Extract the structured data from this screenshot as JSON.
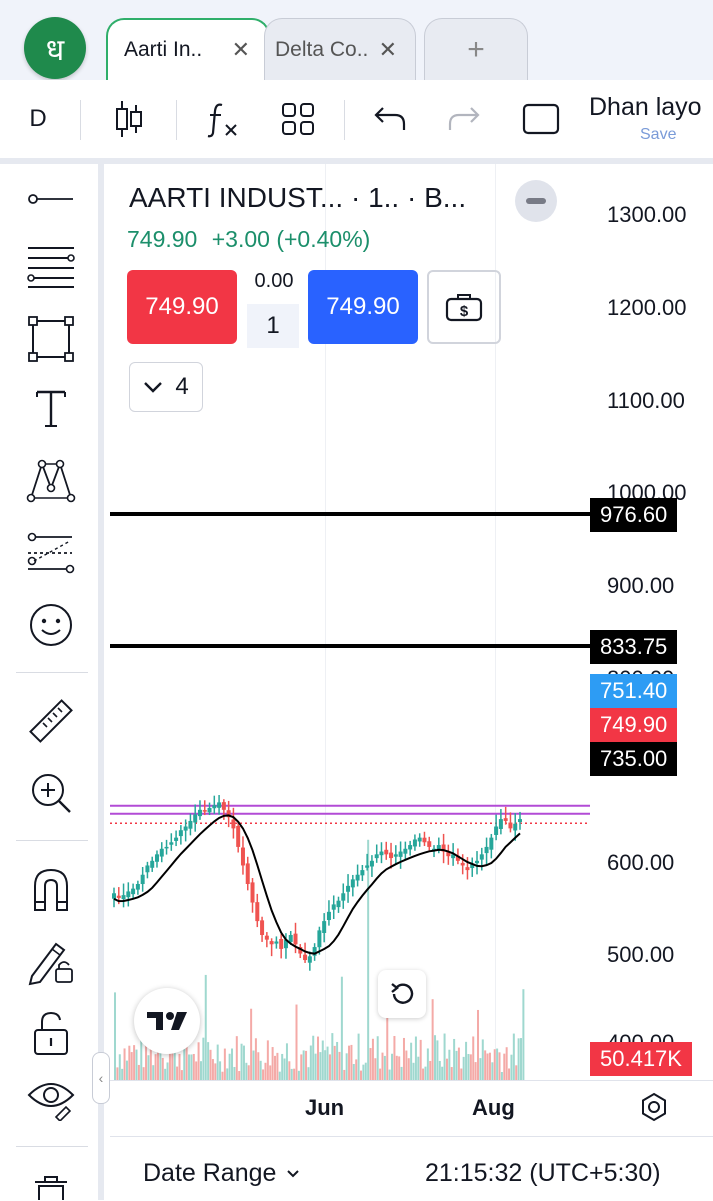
{
  "app": {
    "logo_glyph": "ध"
  },
  "tabs": [
    {
      "label": "Aarti In..",
      "active": true
    },
    {
      "label": "Delta Co..",
      "active": false
    }
  ],
  "new_tab_label": "+",
  "toolbar": {
    "interval": "D",
    "layout_name": "Dhan layo",
    "layout_save": "Save"
  },
  "left_tools": [
    "horizontal-ray",
    "fib-retracement",
    "rectangle",
    "text",
    "pattern",
    "long-position",
    "icon",
    "ruler",
    "zoom-in",
    "magnet",
    "lock-drawing",
    "lock",
    "eye",
    "trash"
  ],
  "symbol": {
    "title": "AARTI INDUST...  · 1..  · B...",
    "last": "749.90",
    "change": "+3.00 (+0.40%)",
    "sell_price": "749.90",
    "buy_price": "749.90",
    "spread": "0.00",
    "quantity": "1",
    "indicators_count": "4"
  },
  "price_axis": [
    "1300.00",
    "1200.00",
    "1100.00",
    "1000.00",
    "900.00",
    "800.00",
    "600.00",
    "500.00",
    "400.00"
  ],
  "price_tags": {
    "line1": "976.60",
    "line2": "833.75",
    "ask": "751.40",
    "last": "749.90",
    "ma": "735.00",
    "volume": "50.417K"
  },
  "time_axis": [
    "Jun",
    "Aug"
  ],
  "bottom": {
    "date_range": "Date Range",
    "clock": "21:15:32 (UTC+5:30)"
  },
  "colors": {
    "up": "#26a69a",
    "down": "#ef5350",
    "accent": "#2962ff",
    "sell": "#f23645",
    "brand": "#1f8a4c"
  },
  "chart_data": {
    "type": "candlestick",
    "title": "AARTI INDUST...  · 1..  · B...",
    "y_range": [
      400,
      1350
    ],
    "horizontal_lines": [
      976.6,
      833.75
    ],
    "last_price": 749.9,
    "ask_price": 751.4,
    "ma_value": 735.0,
    "volume_last": "50.417K",
    "x_labels": [
      "Jun",
      "Aug"
    ],
    "closes": [
      670,
      665,
      668,
      672,
      675,
      680,
      690,
      700,
      705,
      712,
      718,
      720,
      725,
      730,
      738,
      742,
      748,
      755,
      760,
      758,
      762,
      765,
      768,
      760,
      752,
      740,
      720,
      700,
      680,
      660,
      640,
      625,
      620,
      615,
      618,
      610,
      620,
      625,
      615,
      605,
      598,
      602,
      612,
      630,
      640,
      650,
      658,
      662,
      670,
      678,
      685,
      690,
      695,
      700,
      705,
      712,
      715,
      712,
      708,
      712,
      715,
      718,
      722,
      728,
      730,
      725,
      720,
      718,
      722,
      715,
      710,
      712,
      705,
      700,
      695,
      702,
      705,
      712,
      720,
      730,
      742,
      750,
      748,
      740,
      745,
      750
    ]
  }
}
